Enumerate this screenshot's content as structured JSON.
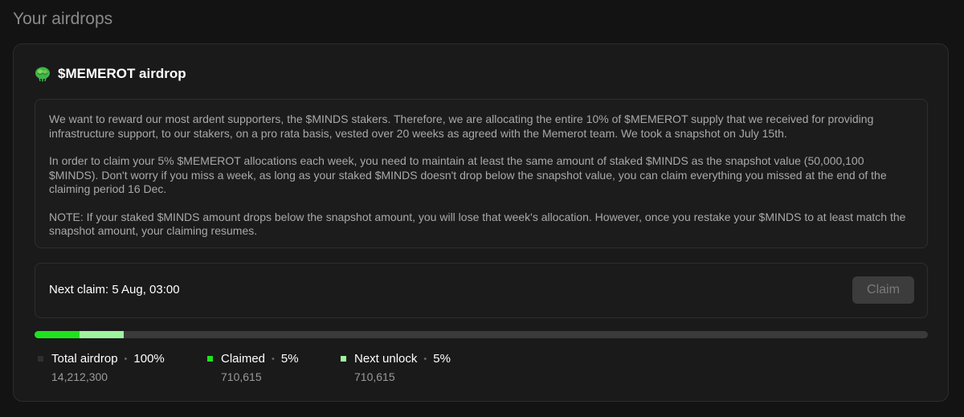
{
  "page": {
    "title": "Your airdrops"
  },
  "airdrop": {
    "title": "$MEMEROT airdrop",
    "icon": "brain-icon",
    "description": [
      "We want to reward our most ardent supporters, the $MINDS stakers. Therefore, we are allocating the entire 10% of $MEMEROT supply that we received for providing infrastructure support, to our stakers, on a pro rata basis, vested over 20 weeks as agreed with the Memerot team. We took a snapshot on July 15th.",
      "In order to claim your 5% $MEMEROT allocations each week, you need to maintain at least the same amount of staked $MINDS as the snapshot value (50,000,100 $MINDS). Don't worry if you miss a week, as long as your staked $MINDS doesn't drop below the snapshot value, you can claim everything you missed at the end of the claiming period 16 Dec.",
      "NOTE: If your staked $MINDS amount drops below the snapshot amount, you will lose that week's allocation. However, once you restake your $MINDS to at least match the snapshot amount, your claiming resumes."
    ],
    "next_claim": "Next claim: 5 Aug, 03:00",
    "claim_button": "Claim",
    "progress": {
      "claimed_fraction": 0.05,
      "next_unlock_fraction": 0.05
    },
    "legend": [
      {
        "label": "Total airdrop",
        "percent": "100%",
        "value": "14,212,300",
        "color": "#2f2f2f"
      },
      {
        "label": "Claimed",
        "percent": "5%",
        "value": "710,615",
        "color": "#1fe21f"
      },
      {
        "label": "Next unlock",
        "percent": "5%",
        "value": "710,615",
        "color": "#9ef59e"
      }
    ],
    "separator": "•"
  },
  "colors": {
    "claimed": "#1fe21f",
    "next_unlock": "#9ef59e",
    "track": "#3a3a3a"
  }
}
